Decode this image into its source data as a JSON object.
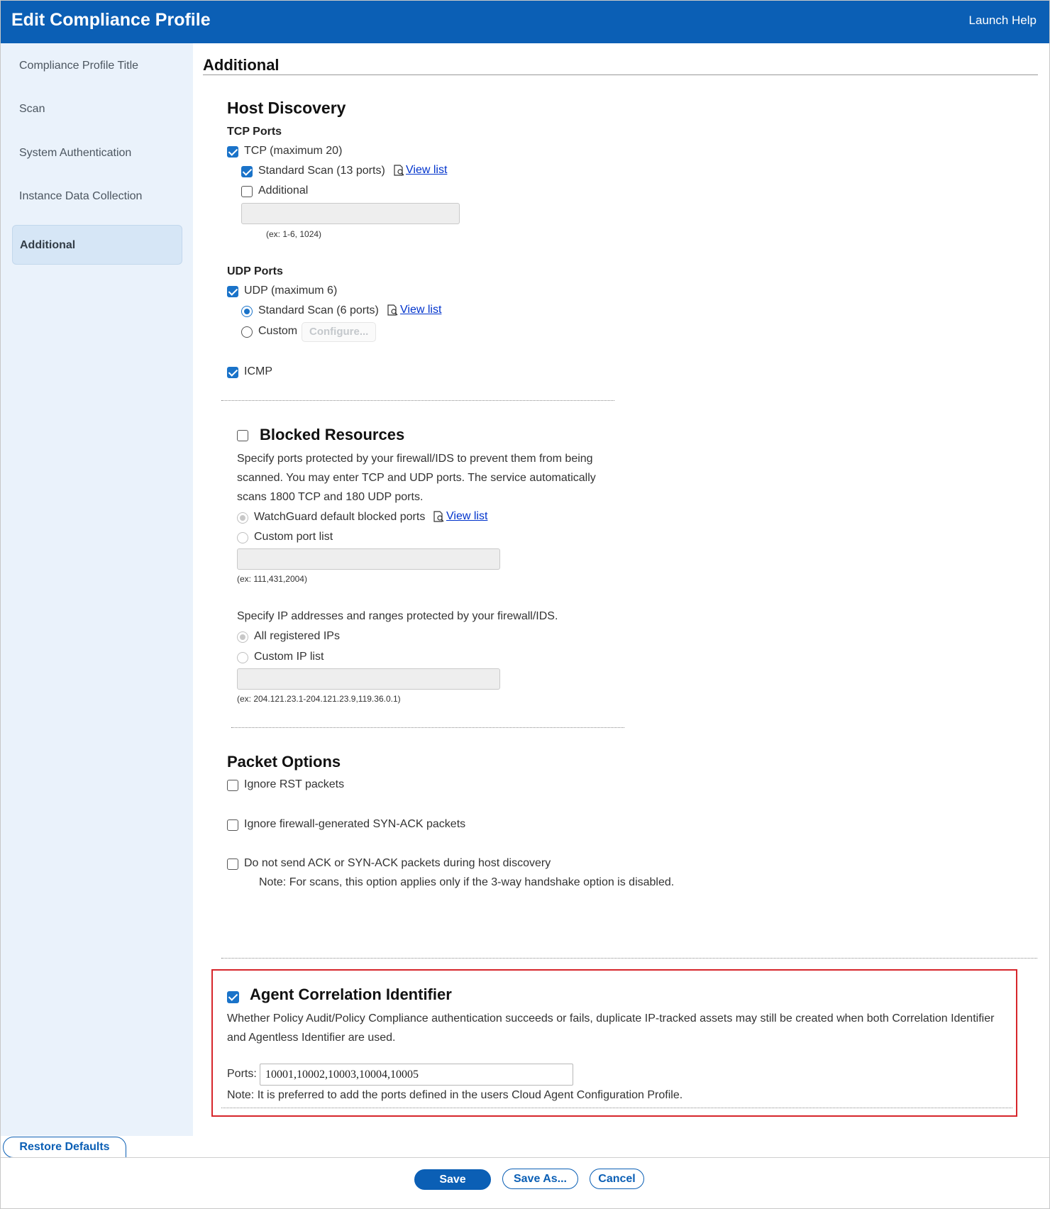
{
  "header": {
    "title": "Edit Compliance Profile",
    "help_label": "Launch Help"
  },
  "sidebar": {
    "items": [
      {
        "label": "Compliance Profile Title"
      },
      {
        "label": "Scan"
      },
      {
        "label": "System Authentication"
      },
      {
        "label": "Instance Data Collection"
      },
      {
        "label": "Additional",
        "active": true
      }
    ]
  },
  "main": {
    "section_title": "Additional"
  },
  "host_discovery": {
    "title": "Host Discovery",
    "tcp": {
      "heading": "TCP Ports",
      "enabled_label": "TCP (maximum 20)",
      "enabled": true,
      "standard_label": "Standard Scan (13 ports)",
      "standard": true,
      "view_list": "View list",
      "additional_label": "Additional",
      "additional": false,
      "additional_value": "",
      "hint": "(ex: 1-6, 1024)"
    },
    "udp": {
      "heading": "UDP Ports",
      "enabled_label": "UDP (maximum 6)",
      "enabled": true,
      "standard_label": "Standard Scan (6 ports)",
      "selected": "standard",
      "view_list": "View list",
      "custom_label": "Custom",
      "configure_label": "Configure..."
    },
    "icmp": {
      "label": "ICMP",
      "enabled": true
    }
  },
  "blocked_resources": {
    "title": "Blocked Resources",
    "enabled": false,
    "description": "Specify ports protected by your firewall/IDS to prevent them from being scanned. You may enter TCP and UDP ports. The service automatically scans 1800 TCP and 180 UDP ports.",
    "default_ports_label": "WatchGuard default blocked ports",
    "view_list": "View list",
    "custom_ports_label": "Custom port list",
    "ports_hint": "(ex: 111,431,2004)",
    "ip_description": "Specify IP addresses and ranges protected by your firewall/IDS.",
    "all_ips_label": "All registered IPs",
    "custom_ips_label": "Custom IP list",
    "ip_hint": "(ex: 204.121.23.1-204.121.23.9,119.36.0.1)"
  },
  "packet_options": {
    "title": "Packet Options",
    "ignore_rst": "Ignore RST packets",
    "ignore_synack": "Ignore firewall-generated SYN-ACK packets",
    "no_ack": "Do not send ACK or SYN-ACK packets during host discovery",
    "note": "Note: For scans, this option applies only if the 3-way handshake option is disabled."
  },
  "agent_correlation": {
    "title": "Agent Correlation Identifier",
    "enabled": true,
    "description": "Whether Policy Audit/Policy Compliance authentication succeeds or fails, duplicate IP-tracked assets may still be created when both Correlation Identifier and Agentless Identifier are used.",
    "ports_label": "Ports:",
    "ports_value": "10001,10002,10003,10004,10005",
    "note": "Note: It is preferred to add the ports defined in the users Cloud Agent Configuration Profile."
  },
  "footer": {
    "restore_label": "Restore Defaults",
    "save_label": "Save",
    "save_as_label": "Save As...",
    "cancel_label": "Cancel"
  },
  "colors": {
    "header": "#0b5fb5",
    "highlight_border": "#d7262b",
    "sidebar": "#eaf2fb"
  }
}
